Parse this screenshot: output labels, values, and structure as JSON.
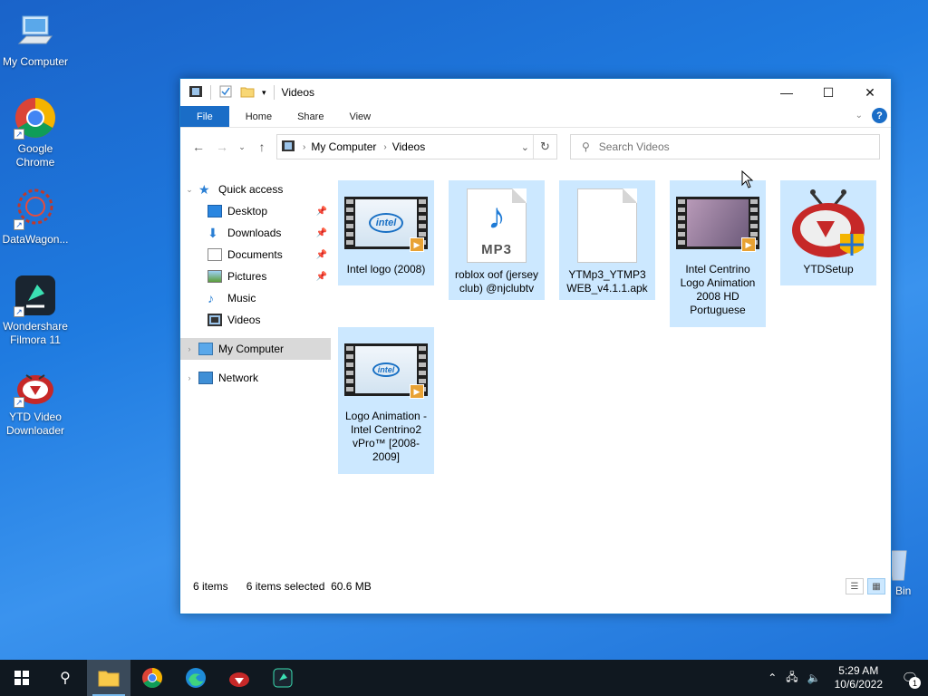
{
  "desktop": {
    "icons": [
      {
        "label": "My Computer"
      },
      {
        "label": "Google Chrome"
      },
      {
        "label": "DataWagon..."
      },
      {
        "label": "Wondershare Filmora 11"
      },
      {
        "label": "YTD Video Downloader"
      }
    ],
    "recycle_bin_label": "Bin"
  },
  "window": {
    "title": "Videos",
    "ribbon_tabs": [
      "File",
      "Home",
      "Share",
      "View"
    ],
    "help_label": "?",
    "breadcrumb": [
      "My Computer",
      "Videos"
    ],
    "search_placeholder": "Search Videos",
    "nav": {
      "quick_access": "Quick access",
      "pinned": [
        "Desktop",
        "Downloads",
        "Documents",
        "Pictures"
      ],
      "unpinned": [
        "Music",
        "Videos"
      ],
      "my_computer": "My Computer",
      "network": "Network"
    },
    "files": [
      {
        "name": "Intel logo (2008)",
        "type": "video"
      },
      {
        "name": "roblox oof (jersey club) @njclubtv",
        "type": "mp3"
      },
      {
        "name": "YTMp3_YTMP3WEB_v4.1.1.apk",
        "type": "file"
      },
      {
        "name": "Intel Centrino Logo Animation 2008 HD Portuguese",
        "type": "video"
      },
      {
        "name": "YTDSetup",
        "type": "app"
      },
      {
        "name": "Logo Animation - Intel Centrino2 vPro™ [2008-2009]",
        "type": "video"
      }
    ],
    "mp3_badge": "MP3",
    "intel_text": "intel",
    "status": {
      "items_count": "6 items",
      "selected": "6 items selected  60.6 MB"
    }
  },
  "taskbar": {
    "time": "5:29 AM",
    "date": "10/6/2022",
    "notification_count": "1"
  }
}
